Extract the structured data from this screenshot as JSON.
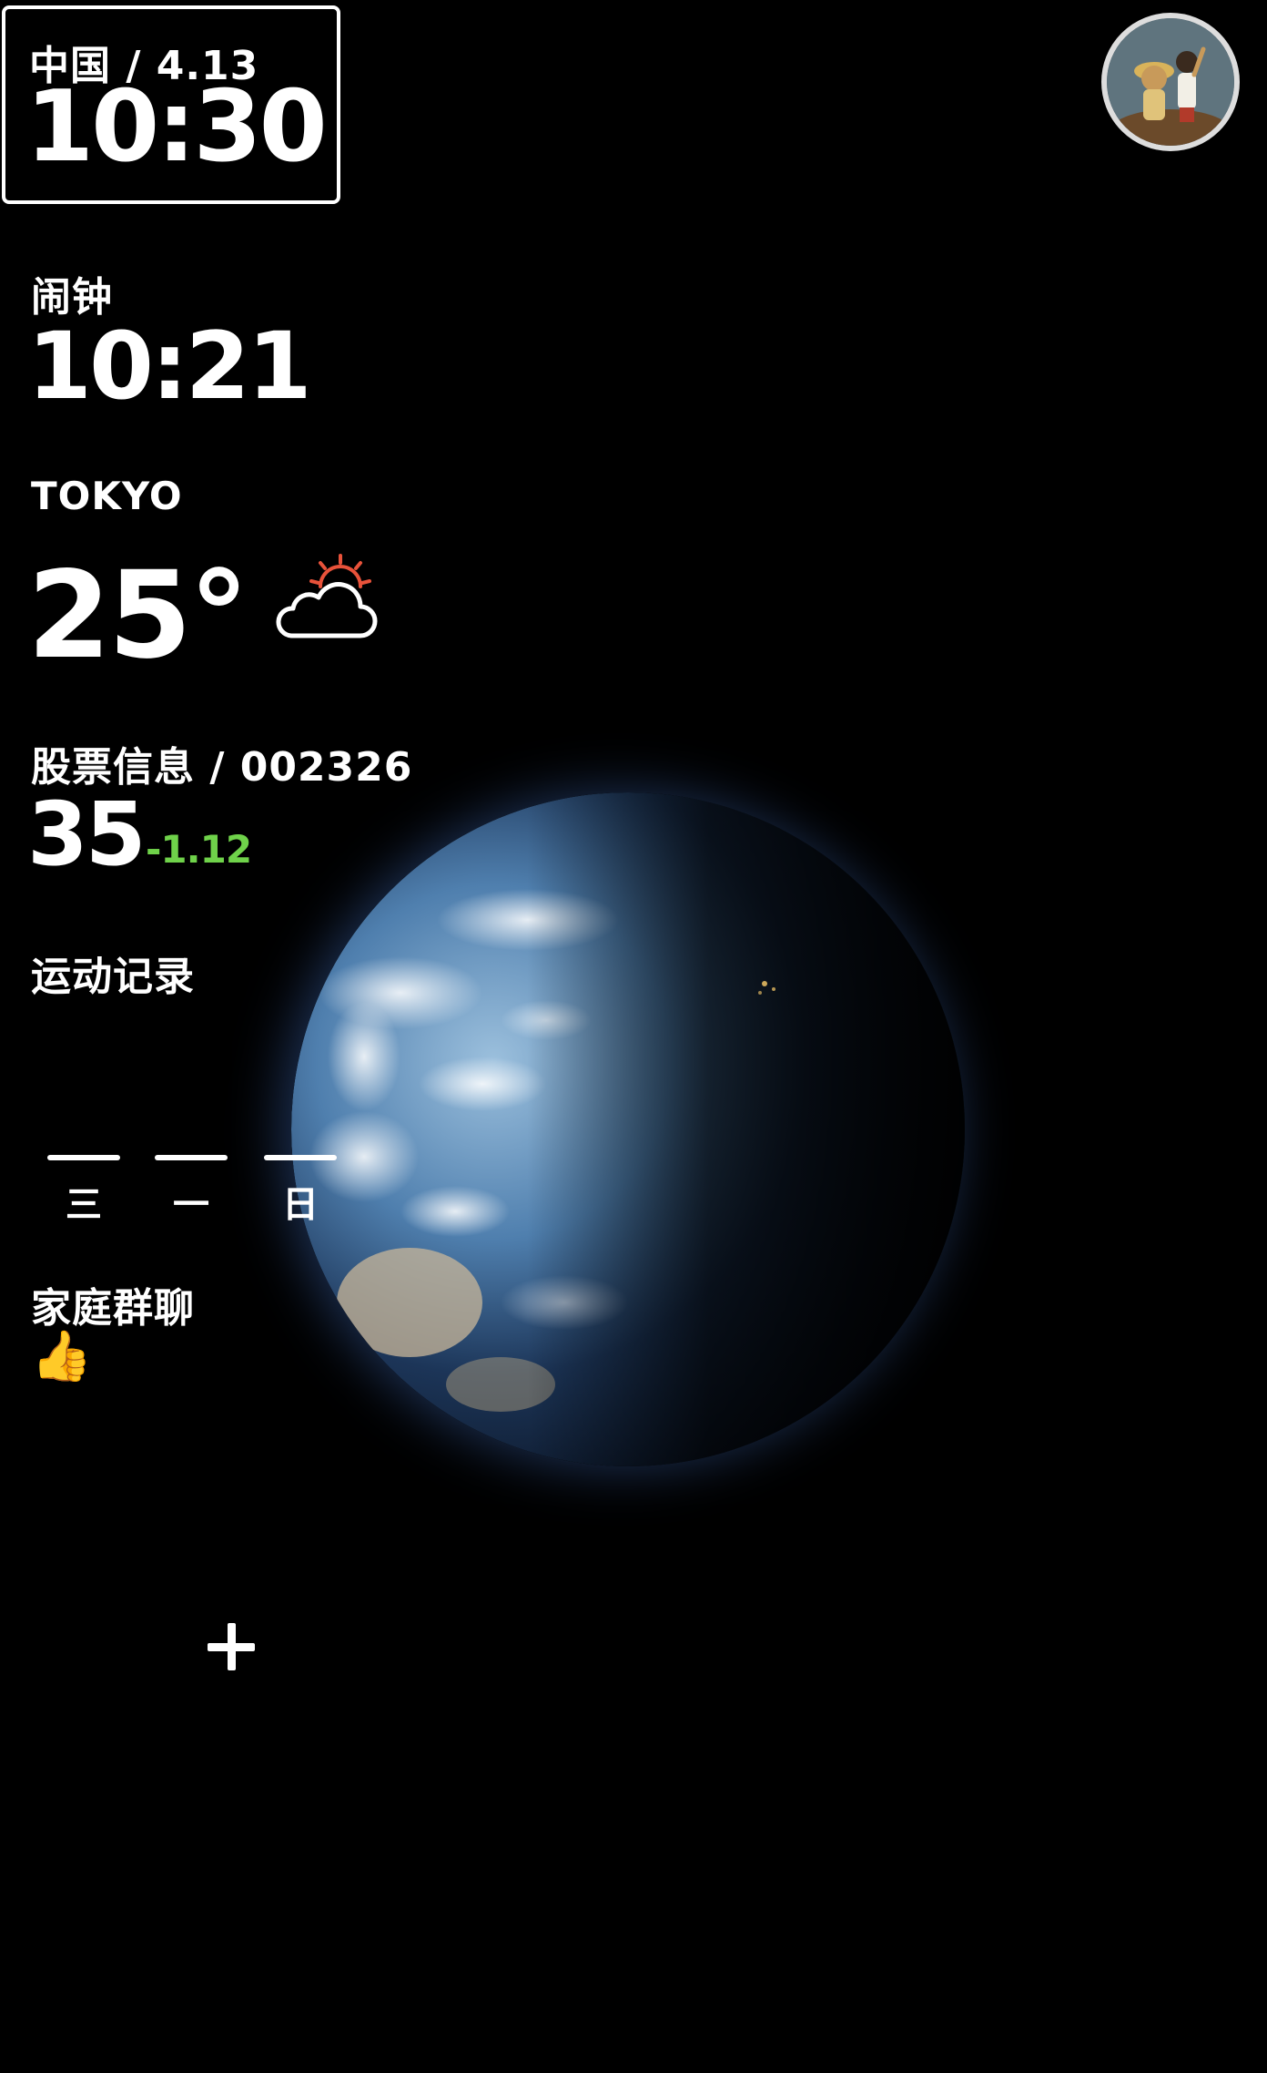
{
  "clock": {
    "subtitle": "中国 / 4.13",
    "time": "10:30"
  },
  "alarm": {
    "label": "闹钟",
    "time": "10:21"
  },
  "weather": {
    "city": "TOKYO",
    "temperature": "25°",
    "icon": "partly-sunny-cloud-icon"
  },
  "stock": {
    "label": "股票信息 / 002326",
    "value": "35",
    "change": "-1.12",
    "change_color": "#6fd24a"
  },
  "sport": {
    "label": "运动记录",
    "days": [
      "三",
      "一",
      "日"
    ]
  },
  "family": {
    "label": "家庭群聊",
    "last_message": "👍"
  },
  "add": {
    "icon": "plus-icon"
  },
  "colors": {
    "background": "#000000",
    "text": "#ffffff",
    "sun": "#e8523a"
  }
}
